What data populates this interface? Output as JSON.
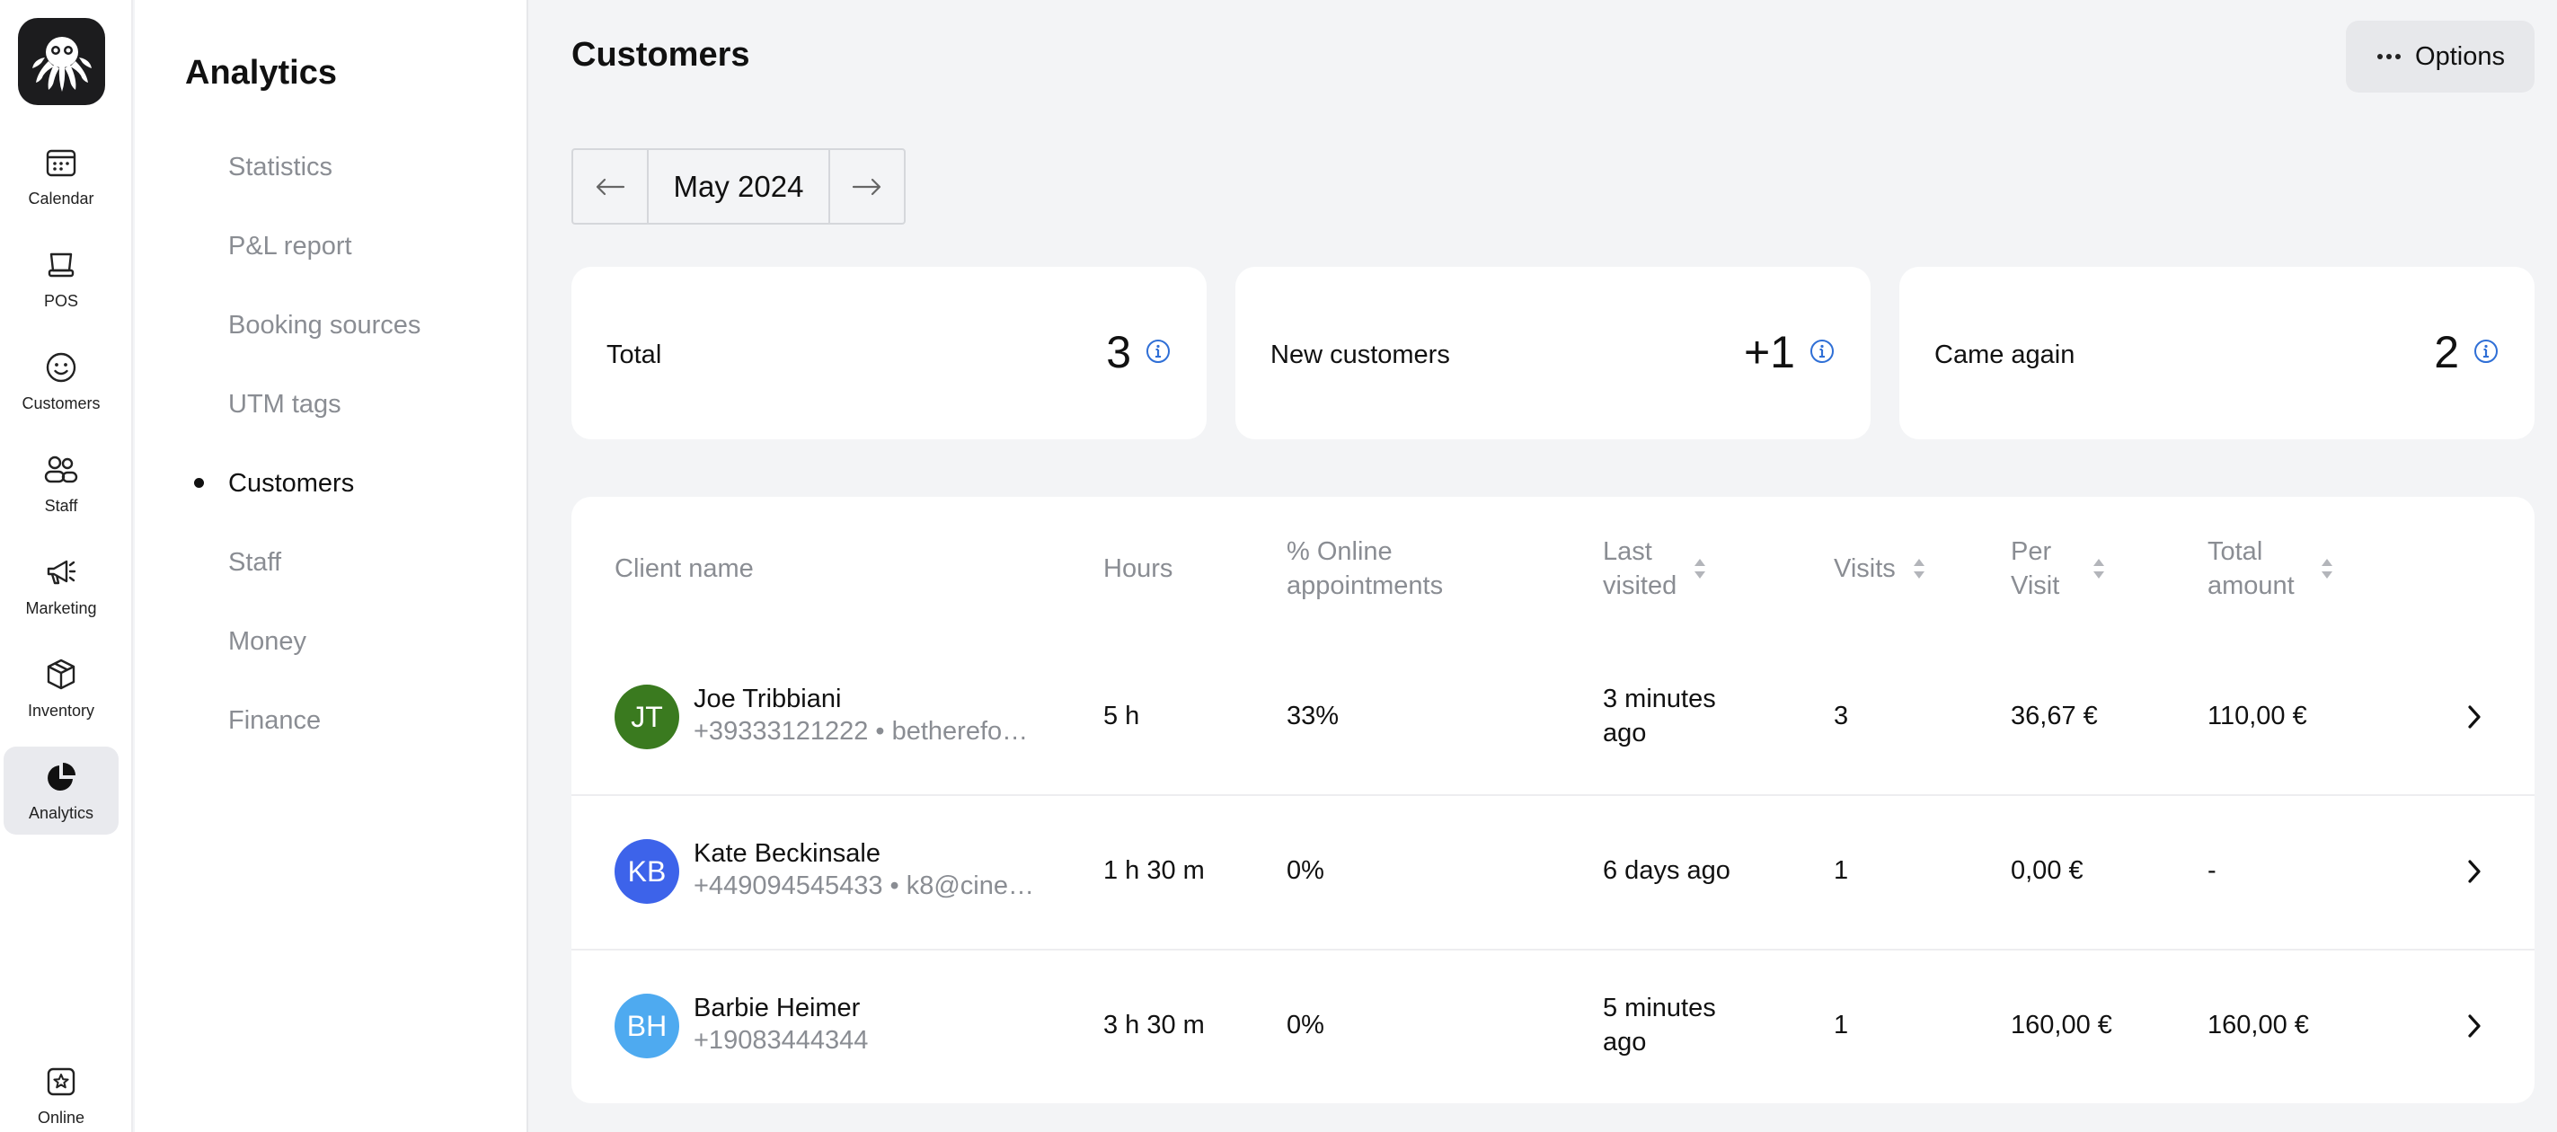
{
  "rail": {
    "items": [
      {
        "label": "Calendar",
        "icon": "calendar-icon"
      },
      {
        "label": "POS",
        "icon": "pos-icon"
      },
      {
        "label": "Customers",
        "icon": "smiley-icon"
      },
      {
        "label": "Staff",
        "icon": "staff-icon"
      },
      {
        "label": "Marketing",
        "icon": "megaphone-icon"
      },
      {
        "label": "Inventory",
        "icon": "box-icon"
      },
      {
        "label": "Analytics",
        "icon": "pie-chart-icon",
        "active": true
      }
    ],
    "bottom": {
      "label": "Online",
      "icon": "star-badge-icon"
    }
  },
  "subnav": {
    "title": "Analytics",
    "items": [
      {
        "label": "Statistics"
      },
      {
        "label": "P&L report"
      },
      {
        "label": "Booking sources"
      },
      {
        "label": "UTM tags"
      },
      {
        "label": "Customers",
        "active": true
      },
      {
        "label": "Staff"
      },
      {
        "label": "Money"
      },
      {
        "label": "Finance"
      }
    ]
  },
  "header": {
    "title": "Customers",
    "options_label": "Options"
  },
  "month_nav": {
    "label": "May 2024"
  },
  "stats": [
    {
      "label": "Total",
      "value": "3"
    },
    {
      "label": "New customers",
      "value": "+1"
    },
    {
      "label": "Came again",
      "value": "2"
    }
  ],
  "table": {
    "headers": {
      "client": "Client name",
      "hours": "Hours",
      "online": "% Online\nappointments",
      "last": "Last\nvisited",
      "visits": "Visits",
      "per": "Per\nVisit",
      "total": "Total\namount"
    },
    "rows": [
      {
        "initials": "JT",
        "avatar_color": "#3a7a1f",
        "name": "Joe Tribbiani",
        "contact": "+39333121222 • betherefo…",
        "hours": "5 h",
        "online": "33%",
        "last": "3 minutes\nago",
        "visits": "3",
        "per": "36,67 €",
        "total": "110,00 €"
      },
      {
        "initials": "KB",
        "avatar_color": "#3d63ea",
        "name": "Kate Beckinsale",
        "contact": "+449094545433 • k8@cine…",
        "hours": "1 h 30 m",
        "online": "0%",
        "last": "6 days ago",
        "visits": "1",
        "per": "0,00 €",
        "total": "-"
      },
      {
        "initials": "BH",
        "avatar_color": "#4eaaf0",
        "name": "Barbie Heimer",
        "contact": "+19083444344",
        "hours": "3 h 30 m",
        "online": "0%",
        "last": "5 minutes\nago",
        "visits": "1",
        "per": "160,00 €",
        "total": "160,00 €"
      }
    ]
  },
  "colors": {
    "accent_info": "#2f6fd6",
    "page_bg": "#f3f4f6",
    "muted_text": "#8a8d93"
  }
}
